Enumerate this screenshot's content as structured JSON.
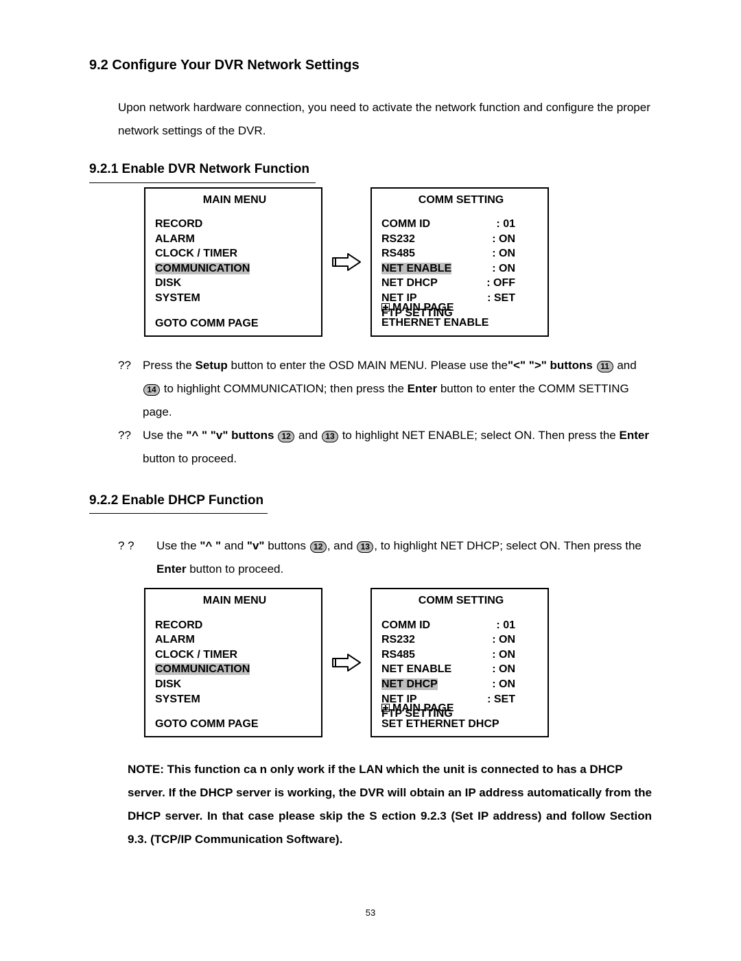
{
  "section_title": "9.2 Configure Your DVR Network Settings",
  "intro": "Upon network hardware connection, you need to activate the network function and configure the proper network settings of the DVR.",
  "s921_title": "9.2.1 Enable  DVR Network Function",
  "main_menu_title": "MAIN MENU",
  "main_menu_items": {
    "record": "RECORD",
    "alarm": "ALARM",
    "clock": "CLOCK / TIMER",
    "comm": "COMMUNICATION",
    "disk": "DISK",
    "system": "SYSTEM"
  },
  "goto_comm_page": "GOTO COMM PAGE",
  "comm_setting_title": "COMM  SETTING",
  "comm1": {
    "comm_id_lbl": "COMM   ID",
    "comm_id_val": ": 01",
    "rs232_lbl": "RS232",
    "rs232_val": ": ON",
    "rs485_lbl": "RS485",
    "rs485_val": ": ON",
    "net_enable_lbl": "NET ENABLE",
    "net_enable_val": ": ON",
    "net_dhcp_lbl": "NET DHCP",
    "net_dhcp_val": ": OFF",
    "net_ip_lbl": "NET IP",
    "net_ip_val": ": SET",
    "ftp_lbl": "FTP SETTING",
    "main_page": "MAIN PAGE",
    "foot": "ETHERNET   ENABLE"
  },
  "comm2": {
    "comm_id_lbl": "COMM   ID",
    "comm_id_val": ": 01",
    "rs232_lbl": "RS232",
    "rs232_val": ": ON",
    "rs485_lbl": "RS485",
    "rs485_val": ": ON",
    "net_enable_lbl": "NET ENABLE",
    "net_enable_val": ": ON",
    "net_dhcp_lbl": "NET DHCP",
    "net_dhcp_val": ": ON",
    "net_ip_lbl": "NET IP",
    "net_ip_val": ": SET",
    "ftp_lbl": "FTP SETTING",
    "main_page": "MAIN PAGE",
    "foot": "SET  ETHERNET DHCP"
  },
  "inst1": {
    "bullet": "??",
    "t1": "Press the ",
    "b1": "Setup",
    "t2": " button to enter the OSD MAIN MENU. Please use the",
    "b2": "\"<\"  \">\" buttons",
    "k1": "11",
    "t3": "and ",
    "k2": "14",
    "t4": " to highlight COMMUNICATION; then press the ",
    "b3": "Enter",
    "t5": " button to enter the COMM SETTING page."
  },
  "inst2": {
    "bullet": "??",
    "t1": "Use the ",
    "b1": "\"^ \"  \"v\" buttons",
    "k1": "12",
    "t2": " and ",
    "k2": "13",
    "t3": " to highlight NET ENABLE; select ON. Then press the ",
    "b2": "Enter",
    "t4": " button to proceed."
  },
  "s922_title": "9.2.2 Enable DHCP Function",
  "inst3": {
    "bullet": "? ?",
    "t1": "Use the ",
    "b1": "\"^ \"",
    "t2": " and ",
    "b2": "\"v\"",
    "t3": " buttons ",
    "k1": "12",
    "t4": ", and ",
    "k2": "13",
    "t5": ", to highlight NET DHCP; select ON. Then press the ",
    "b3": "Enter",
    "t6": " button to proceed."
  },
  "note": {
    "l1a": "NOTE: This function ca n only work if the LAN which the unit is connected to has a DHCP",
    "l1b": "server. If the DHCP server is working, the DVR will obtain an IP address automatically from the DHCP server. In that case please skip  the  S ection  9.2.3 (Set IP address) and follow Section 9.3. (TCP/IP Communication Software)."
  },
  "page": "53"
}
